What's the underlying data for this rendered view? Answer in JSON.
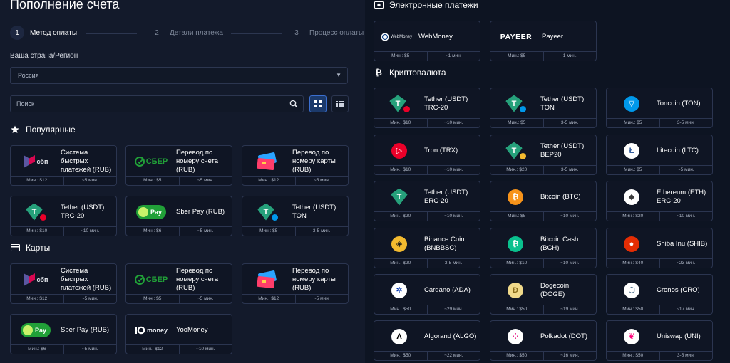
{
  "page": {
    "title": "Пополнение счета"
  },
  "steps": [
    {
      "num": "1",
      "label": "Метод оплаты"
    },
    {
      "num": "2",
      "label": "Детали платежа"
    },
    {
      "num": "3",
      "label": "Процесс оплаты"
    }
  ],
  "region": {
    "label": "Ваша страна/Регион",
    "value": "Россия"
  },
  "search": {
    "placeholder": "Поиск"
  },
  "sections": {
    "popular": "Популярные",
    "cards": "Карты",
    "epay": "Электронные платежи",
    "crypto": "Криптовалюта"
  },
  "popular": [
    {
      "name": "Система быстрых платежей (RUB)",
      "min": "Мин.: $12",
      "time": "~5 мин."
    },
    {
      "name": "Перевод по номеру счета (RUB)",
      "min": "Мин.: $5",
      "time": "~5 мин."
    },
    {
      "name": "Перевод по номеру карты (RUB)",
      "min": "Мин.: $12",
      "time": "~5 мин."
    },
    {
      "name": "Tether (USDT) TRC-20",
      "min": "Мин.: $10",
      "time": "~10 мин."
    },
    {
      "name": "Sber Pay (RUB)",
      "min": "Мин.: $6",
      "time": "~5 мин."
    },
    {
      "name": "Tether (USDT) TON",
      "min": "Мин.: $5",
      "time": "3-5 мин."
    }
  ],
  "cards": [
    {
      "name": "Система быстрых платежей (RUB)",
      "min": "Мин.: $12",
      "time": "~5 мин."
    },
    {
      "name": "Перевод по номеру счета (RUB)",
      "min": "Мин.: $5",
      "time": "~5 мин."
    },
    {
      "name": "Перевод по номеру карты (RUB)",
      "min": "Мин.: $12",
      "time": "~5 мин."
    },
    {
      "name": "Sber Pay (RUB)",
      "min": "Мин.: $6",
      "time": "~5 мин."
    },
    {
      "name": "YooMoney",
      "min": "Мин.: $12",
      "time": "~10 мин."
    }
  ],
  "epay": [
    {
      "name": "WebMoney",
      "logo": "WebMoney",
      "min": "Мин.: $5",
      "time": "~1 мин."
    },
    {
      "name": "Payeer",
      "logo": "PAYEER",
      "min": "Мин.: $5",
      "time": "1 мин."
    }
  ],
  "logos": {
    "sbp": "сбп",
    "sber": "СБЕР",
    "pay": "Pay",
    "yoomoney": "money"
  },
  "crypto": [
    {
      "name": "Tether (USDT) TRC-20",
      "min": "Мин.: $10",
      "time": "~10 мин."
    },
    {
      "name": "Tether (USDT) TON",
      "min": "Мин.: $5",
      "time": "3-5 мин."
    },
    {
      "name": "Toncoin (TON)",
      "min": "Мин.: $5",
      "time": "3-5 мин."
    },
    {
      "name": "Tron (TRX)",
      "min": "Мин.: $10",
      "time": "~10 мин."
    },
    {
      "name": "Tether (USDT) BEP20",
      "min": "Мин.: $20",
      "time": "3-5 мин."
    },
    {
      "name": "Litecoin (LTC)",
      "min": "Мин.: $5",
      "time": "~5 мин."
    },
    {
      "name": "Tether (USDT) ERC-20",
      "min": "Мин.: $20",
      "time": "~10 мин."
    },
    {
      "name": "Bitcoin (BTC)",
      "min": "Мин.: $5",
      "time": "~10 мин."
    },
    {
      "name": "Ethereum (ETH) ERC-20",
      "min": "Мин.: $20",
      "time": "~10 мин."
    },
    {
      "name": "Binance Coin (BNBBSC)",
      "min": "Мин.: $20",
      "time": "3-5 мин."
    },
    {
      "name": "Bitcoin Cash (BCH)",
      "min": "Мин.: $10",
      "time": "~10 мин."
    },
    {
      "name": "Shiba Inu (SHIB)",
      "min": "Мин.: $40",
      "time": "~23 мин."
    },
    {
      "name": "Cardano (ADA)",
      "min": "Мин.: $50",
      "time": "~29 мин."
    },
    {
      "name": "Dogecoin (DOGE)",
      "min": "Мин.: $50",
      "time": "~19 мин."
    },
    {
      "name": "Cronos (CRO)",
      "min": "Мин.: $50",
      "time": "~17 мин."
    },
    {
      "name": "Algorand (ALGO)",
      "min": "Мин.: $50",
      "time": "~22 мин."
    },
    {
      "name": "Polkadot (DOT)",
      "min": "Мин.: $50",
      "time": "~16 мин."
    },
    {
      "name": "Uniswap (UNI)",
      "min": "Мин.: $50",
      "time": "3-5 мин."
    }
  ],
  "colors": {
    "tether": "#26a17b",
    "ton": "#0098ea",
    "tron": "#eb0029",
    "ltc": "#345d9d",
    "btc": "#f7931a",
    "eth": "#627eea",
    "bnb": "#f3ba2f",
    "bch": "#0ac18e",
    "shib": "#e42d04",
    "ada": "#0033ad",
    "doge": "#c2a633",
    "cro": "#103f68",
    "algo": "#000000",
    "dot": "#e6007a",
    "uni": "#ff007a",
    "sber": "#21a038",
    "accent": "#3b6fd0"
  }
}
